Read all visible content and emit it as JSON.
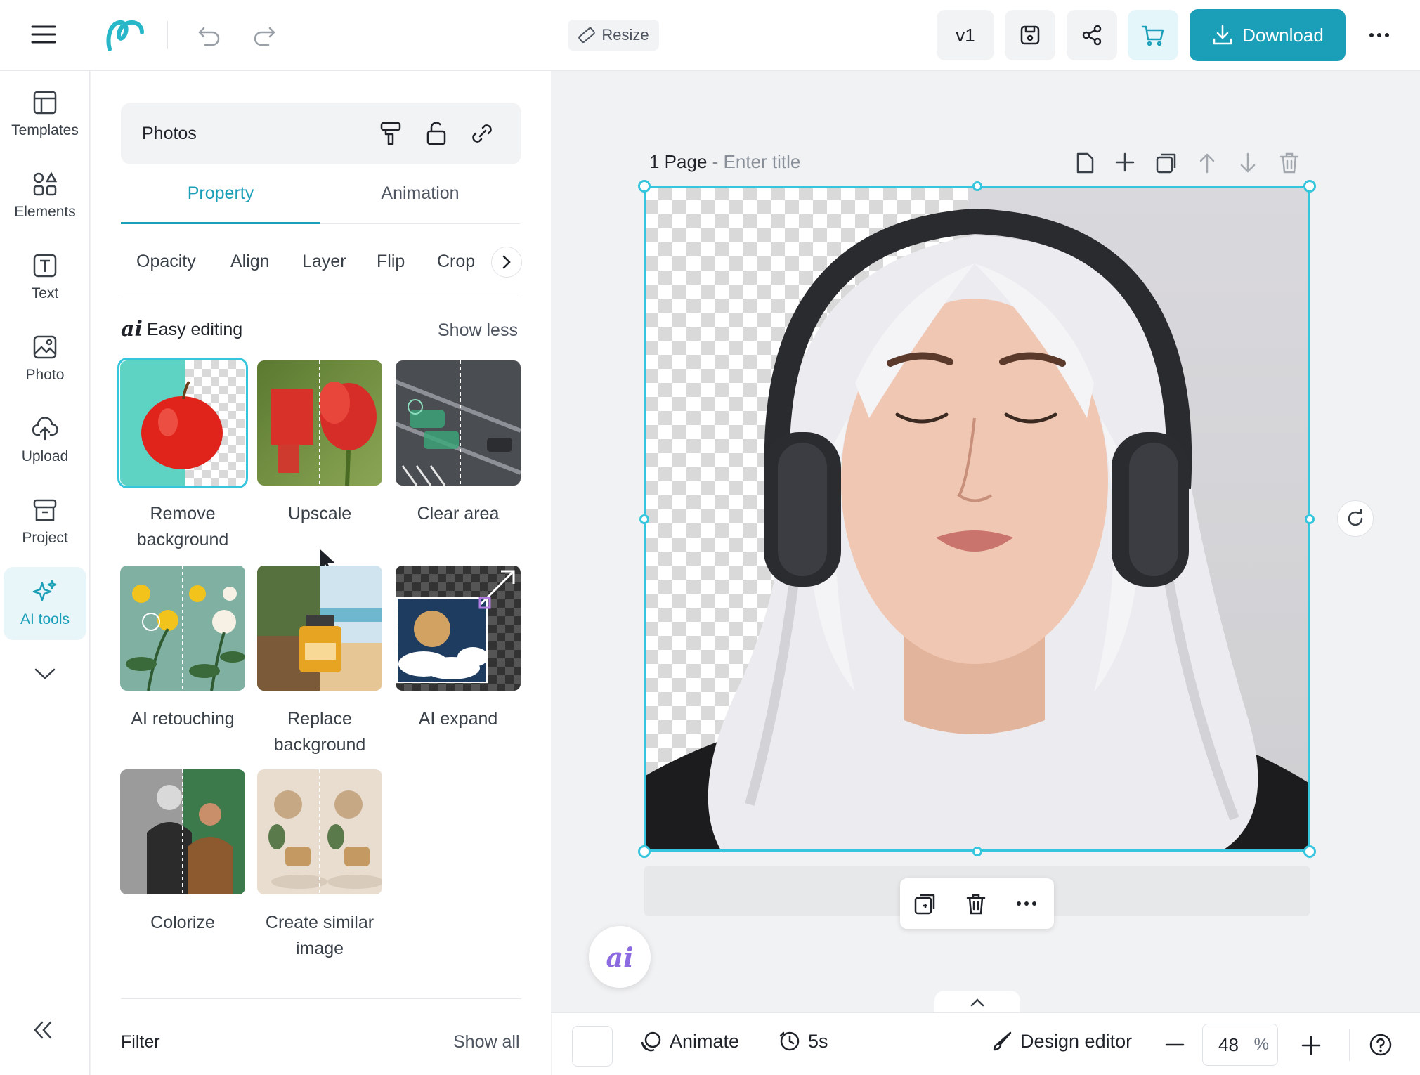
{
  "topbar": {
    "resize_label": "Resize",
    "version_label": "v1",
    "download_label": "Download",
    "accent": "#1b9fb8"
  },
  "leftrail": {
    "items": [
      {
        "label": "Templates",
        "icon": "template-icon"
      },
      {
        "label": "Elements",
        "icon": "elements-icon"
      },
      {
        "label": "Text",
        "icon": "text-icon"
      },
      {
        "label": "Photo",
        "icon": "photo-icon"
      },
      {
        "label": "Upload",
        "icon": "upload-icon"
      },
      {
        "label": "Project",
        "icon": "project-icon"
      },
      {
        "label": "AI tools",
        "icon": "sparkle-icon",
        "active": true
      }
    ]
  },
  "panel": {
    "header_title": "Photos",
    "tabs": [
      "Property",
      "Animation"
    ],
    "subtabs": [
      "Opacity",
      "Align",
      "Layer",
      "Flip",
      "Crop"
    ],
    "easy_editing": {
      "title": "Easy editing",
      "toggle": "Show less",
      "tools": [
        {
          "label": "Remove background"
        },
        {
          "label": "Upscale"
        },
        {
          "label": "Clear area"
        },
        {
          "label": "AI retouching"
        },
        {
          "label": "Replace background"
        },
        {
          "label": "AI expand"
        },
        {
          "label": "Colorize"
        },
        {
          "label": "Create similar image"
        }
      ]
    },
    "filter": {
      "title": "Filter",
      "toggle": "Show all"
    }
  },
  "canvas": {
    "page_label": "1 Page",
    "title_placeholder": "Enter title"
  },
  "bottombar": {
    "animate_label": "Animate",
    "duration_label": "5s",
    "design_editor_label": "Design editor",
    "zoom_value": "48",
    "zoom_unit": "%"
  }
}
